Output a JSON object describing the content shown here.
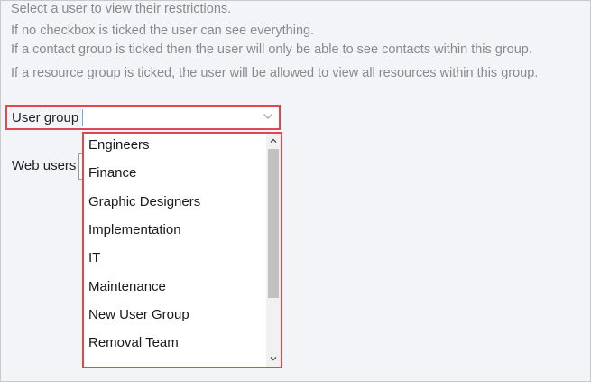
{
  "instructions": [
    "Select a user to view their restrictions.",
    "If no checkbox is ticked the user can see everything.",
    "If a contact group is ticked then the user will only be able to see contacts within this group.",
    "If a resource group is ticked, the user will be allowed to view all resources within this group."
  ],
  "user_group": {
    "label": "User group",
    "value": "",
    "options": [
      "Engineers",
      "Finance",
      "Graphic Designers",
      "Implementation",
      "IT",
      "Maintenance",
      "New User Group",
      "Removal Team"
    ]
  },
  "web_users": {
    "label": "Web users"
  },
  "colors": {
    "highlight": "#e0484d",
    "caret": "#6ea6e0"
  },
  "icons": {
    "dropdown": "chevron-down-icon",
    "scroll_up": "scroll-up-arrow-icon",
    "scroll_down": "scroll-down-arrow-icon"
  }
}
